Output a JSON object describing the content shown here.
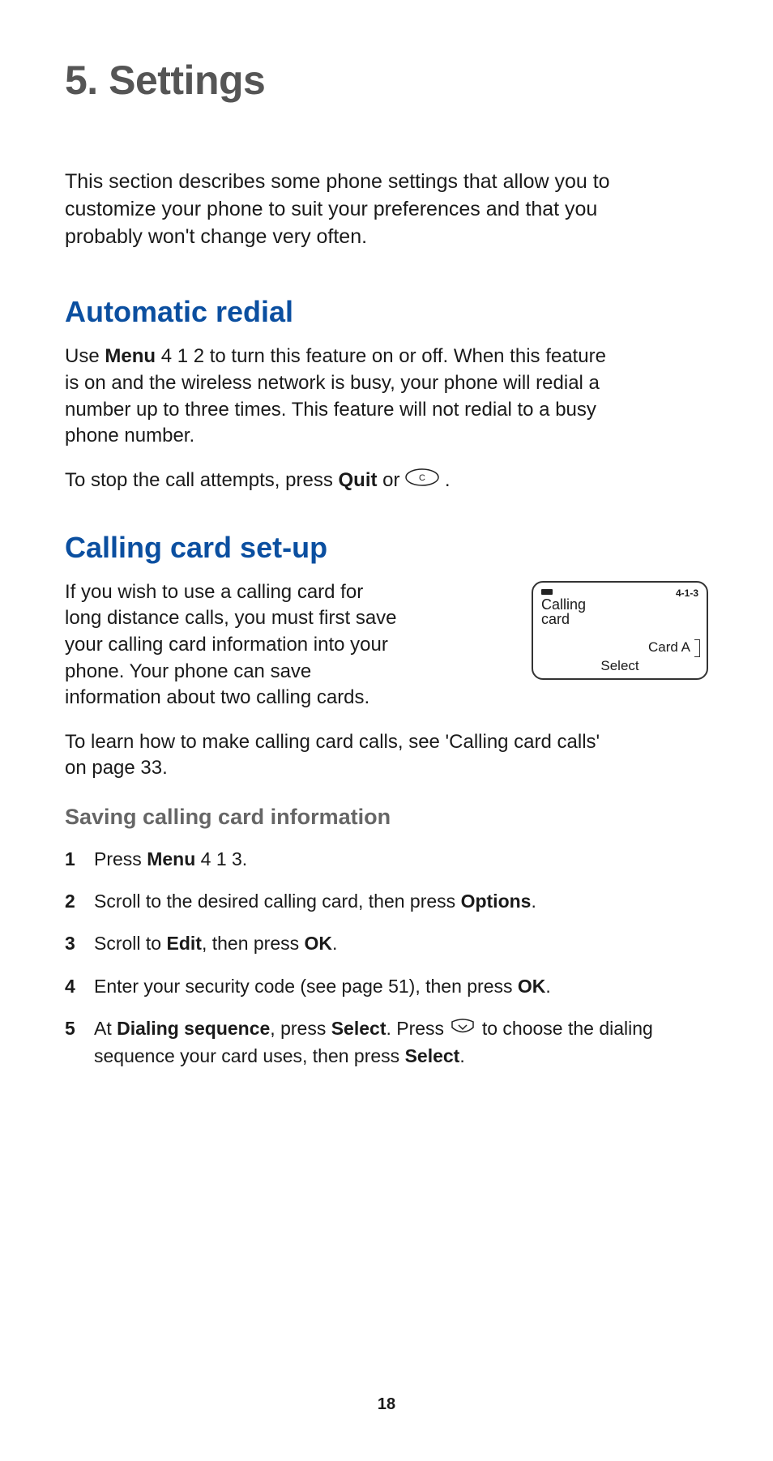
{
  "page_number": "18",
  "h1": "5. Settings",
  "intro": "This section describes some phone settings that allow you to customize your phone to suit your preferences and that you probably won't change very often.",
  "section1": {
    "heading": "Automatic redial",
    "p1_a": "Use ",
    "p1_menu": "Menu",
    "p1_b": " 4 1 2 to turn this feature on or off. When this feature is on and the wireless network is busy, your phone will redial a number up to three times. This feature will not redial to a busy phone number.",
    "p2_a": "To stop the call attempts, press ",
    "p2_quit": "Quit",
    "p2_b": " or ",
    "p2_c": " ."
  },
  "section2": {
    "heading": "Calling card set-up",
    "p1": "If you wish to use a calling card for long distance calls, you must first save your calling card information into your phone. Your phone can save information about two calling cards.",
    "p2": "To learn how to make calling card calls, see 'Calling card calls' on page 33.",
    "screen": {
      "menu_path": "4-1-3",
      "title_line1": "Calling",
      "title_line2": "card",
      "item": "Card A",
      "softkey": "Select"
    },
    "sub_heading": "Saving calling card information",
    "steps": {
      "s1_num": "1",
      "s1_a": "Press ",
      "s1_menu": "Menu",
      "s1_b": " 4 1 3.",
      "s2_num": "2",
      "s2_a": "Scroll to the desired calling card, then press ",
      "s2_options": "Options",
      "s2_b": ".",
      "s3_num": "3",
      "s3_a": "Scroll to ",
      "s3_edit": "Edit",
      "s3_b": ", then press ",
      "s3_ok": "OK",
      "s3_c": ".",
      "s4_num": "4",
      "s4_a": "Enter your security code (see page 51), then press ",
      "s4_ok": "OK",
      "s4_b": ".",
      "s5_num": "5",
      "s5_a": "At ",
      "s5_dial": "Dialing sequence",
      "s5_b": ", press ",
      "s5_select1": "Select",
      "s5_c": ". Press ",
      "s5_d": " to choose the dialing sequence your card uses, then press ",
      "s5_select2": "Select",
      "s5_e": "."
    }
  }
}
